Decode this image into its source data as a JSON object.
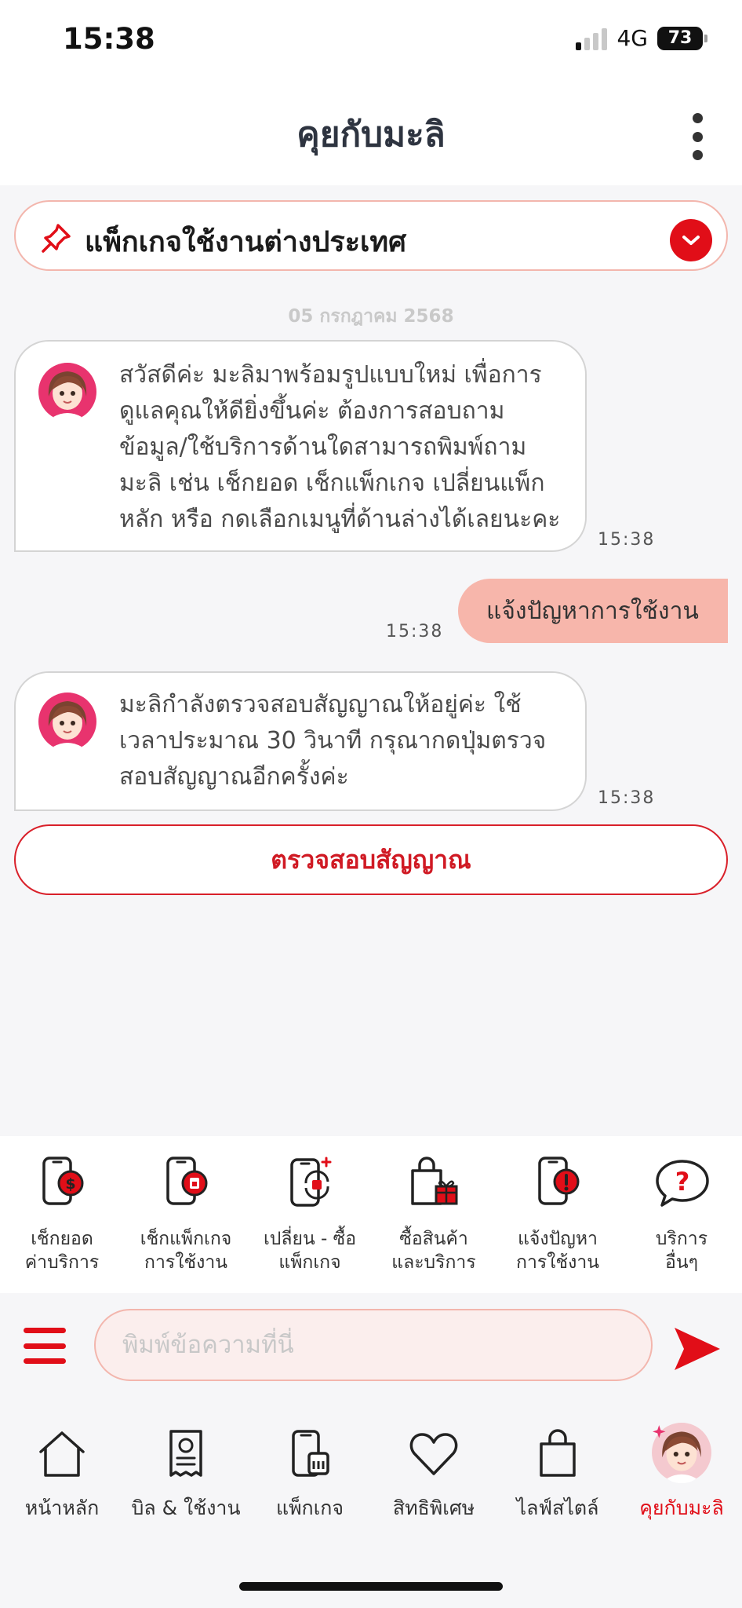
{
  "status": {
    "time": "15:38",
    "network": "4G",
    "battery": "73"
  },
  "header": {
    "title": "คุยกับมะลิ",
    "menu_icon": "more-vertical-icon"
  },
  "pinned": {
    "text": "แพ็กเกจใช้งานต่างประเทศ",
    "icon": "pin-icon",
    "toggle_icon": "chevron-down-icon"
  },
  "chat": {
    "date": "05 กรกฎาคม 2568",
    "messages": [
      {
        "from": "bot",
        "lines": [
          "สวัสดีค่ะ มะลิมาพร้อมรูปแบบใหม่ เพื่อการ",
          "ดูแลคุณให้ดียิ่งขึ้นค่ะ ต้องการสอบถาม",
          "ข้อมูล/ใช้บริการด้านใดสามารถพิมพ์ถาม",
          "มะลิ เช่น เช็กยอด เช็กแพ็กเกจ เปลี่ยนแพ็ก",
          "หลัก หรือ กดเลือกเมนูที่ด้านล่างได้เลยนะคะ"
        ],
        "time": "15:38"
      },
      {
        "from": "user",
        "text": "แจ้งปัญหาการใช้งาน",
        "time": "15:38"
      },
      {
        "from": "bot",
        "lines": [
          "มะลิกำลังตรวจสอบสัญญาณให้อยู่ค่ะ ใช้",
          "เวลาประมาณ 30 วินาที กรุณากดปุ่มตรวจ",
          "สอบสัญญาณอีกครั้งค่ะ"
        ],
        "time": "15:38"
      }
    ],
    "action_button": "ตรวจสอบสัญญาณ"
  },
  "quick_menu": [
    {
      "line1": "เช็กยอด",
      "line2": "ค่าบริการ",
      "icon": "phone-balance-icon"
    },
    {
      "line1": "เช็กแพ็กเกจ",
      "line2": "การใช้งาน",
      "icon": "phone-package-icon"
    },
    {
      "line1": "เปลี่ยน - ซื้อ",
      "line2": "แพ็กเกจ",
      "icon": "phone-swap-icon"
    },
    {
      "line1": "ซื้อสินค้า",
      "line2": "และบริการ",
      "icon": "shopping-gift-icon"
    },
    {
      "line1": "แจ้งปัญหา",
      "line2": "การใช้งาน",
      "icon": "phone-alert-icon"
    },
    {
      "line1": "บริการ",
      "line2": "อื่นๆ",
      "icon": "question-bubble-icon"
    }
  ],
  "composer": {
    "placeholder": "พิมพ์ข้อความที่นี่",
    "menu_icon": "hamburger-icon",
    "send_icon": "send-icon"
  },
  "tabbar": [
    {
      "label": "หน้าหลัก",
      "icon": "home-icon"
    },
    {
      "label": "บิล & ใช้งาน",
      "icon": "bill-icon"
    },
    {
      "label": "แพ็กเกจ",
      "icon": "package-icon"
    },
    {
      "label": "สิทธิพิเศษ",
      "icon": "heart-icon"
    },
    {
      "label": "ไลฟ์สไตล์",
      "icon": "shopping-bag-icon"
    },
    {
      "label": "คุยกับมะลิ",
      "icon": "mali-avatar-icon",
      "active": true
    }
  ],
  "colors": {
    "brand_red": "#e10e18",
    "user_bubble": "#f7b6ab",
    "background": "#f6f6f8"
  }
}
